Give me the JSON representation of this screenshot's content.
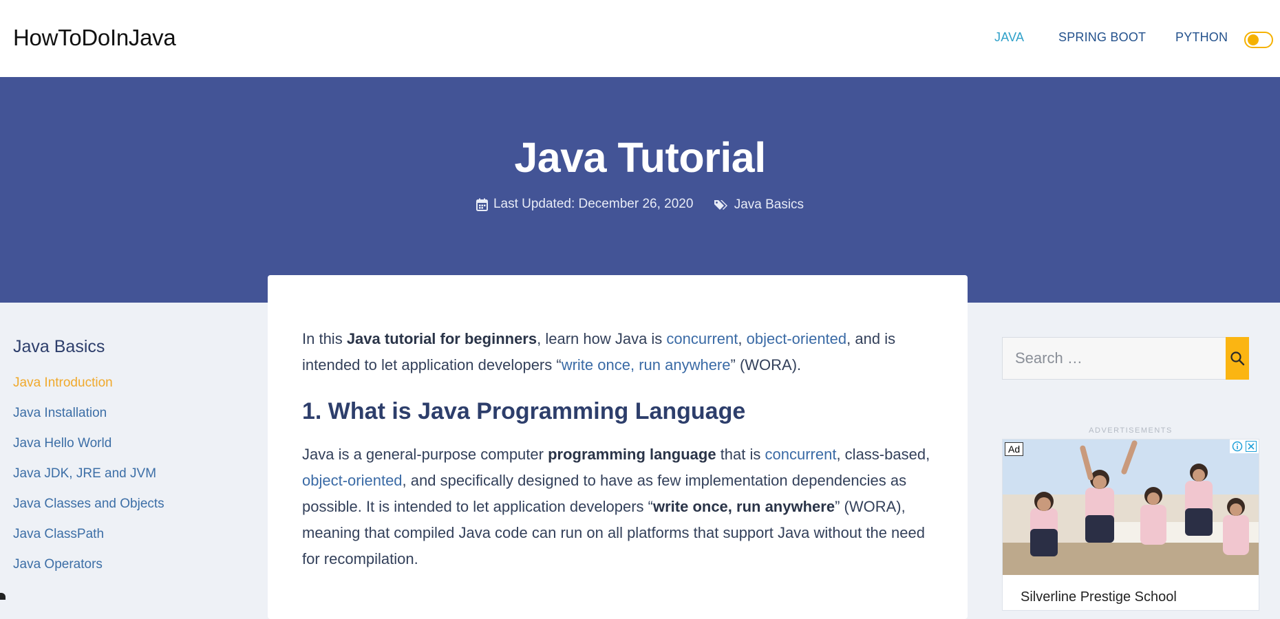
{
  "header": {
    "brand": "HowToDoInJava",
    "nav": [
      {
        "label": "JAVA",
        "active": true
      },
      {
        "label": "SPRING BOOT",
        "active": false
      },
      {
        "label": "PYTHON",
        "active": false
      }
    ],
    "theme_toggle_icon": "toggle-icon"
  },
  "hero": {
    "title": "Java Tutorial",
    "last_updated": "Last Updated: December 26, 2020",
    "category": "Java Basics",
    "calendar_icon": "calendar-icon",
    "tags_icon": "tags-icon"
  },
  "sidebar": {
    "title": "Java Basics",
    "items": [
      {
        "label": "Java Introduction",
        "current": true
      },
      {
        "label": "Java Installation"
      },
      {
        "label": "Java Hello World"
      },
      {
        "label": "Java JDK, JRE and JVM"
      },
      {
        "label": "Java Classes and Objects"
      },
      {
        "label": "Java ClassPath"
      },
      {
        "label": "Java Operators"
      }
    ]
  },
  "article": {
    "intro": {
      "t1": "In this ",
      "b1": "Java tutorial for beginners",
      "t2": ", learn how Java is ",
      "l1": "concurrent",
      "t3": ", ",
      "l2": "object-oriented",
      "t4": ", and is intended to let application developers “",
      "l3": "write once, run anywhere",
      "t5": "” (WORA)."
    },
    "h1": "1. What is Java Programming Language",
    "p2": {
      "t1": "Java is a general-purpose computer ",
      "b1": "programming language",
      "t2": " that is ",
      "l1": "concurrent",
      "t3": ", class-based, ",
      "l2": "object-oriented",
      "t4": ", and specifically designed to have as few implementation dependencies as possible. It is intended to let application developers “",
      "b2": "write once, run anywhere",
      "t5": "” (WORA), meaning that compiled Java code can run on all platforms that support Java without the need for recompilation."
    }
  },
  "search": {
    "placeholder": "Search …",
    "button_icon": "search-icon"
  },
  "ads": {
    "label": "ADVERTISEMENTS",
    "badge": "Ad",
    "caption": "Silverline Prestige School"
  }
}
